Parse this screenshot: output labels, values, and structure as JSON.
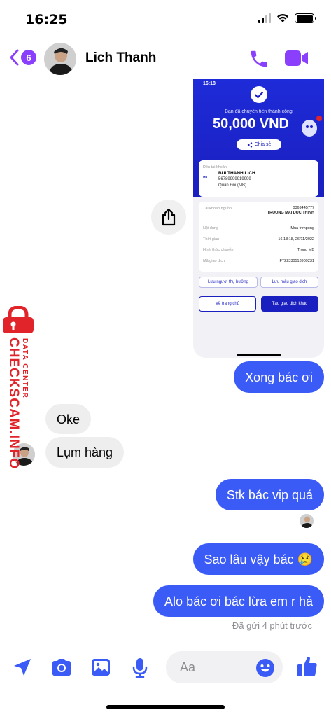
{
  "status_bar": {
    "time": "16:25"
  },
  "header": {
    "back_count": "6",
    "contact_name": "Lich Thanh"
  },
  "transfer_screenshot": {
    "time": "16:18",
    "message": "Bạn đã chuyển tiền thành công",
    "amount": "50,000 VND",
    "share_label": "Chia sẻ",
    "to_label": "Đến tài khoản",
    "recipient_name": "BUI THANH LICH",
    "recipient_account": "56789999919999",
    "recipient_bank": "Quân Đội (MB)",
    "bank_logo": "MB",
    "source_label": "Tài khoản nguồn",
    "source_account": "0369445777",
    "source_name": "TRUONG MAI DUC THINH",
    "content_label": "Nội dung",
    "content_value": "Mua frimpong",
    "time_label": "Thời gian",
    "time_value": "16:18:18, 26/11/2022",
    "method_label": "Hình thức chuyển",
    "method_value": "Trong MB",
    "txn_label": "Mã giao dịch",
    "txn_value": "FT22330513909231",
    "save_recipient": "Lưu người thụ hưởng",
    "save_template": "Lưu mẫu giao dịch",
    "home_button": "Về trang chủ",
    "new_txn_button": "Tạo giao dịch khác"
  },
  "messages": {
    "m1": "Xong bác ơi",
    "m2": "Oke",
    "m3": "Lụm hàng",
    "m4": "Stk bác vip quá",
    "m5": "Sao lâu vậy bác 😢",
    "m6": "Alo bác ơi bác lừa em r hả"
  },
  "sent_status": "Đã gửi 4 phút trước",
  "watermark": {
    "main": "CHECKSCAM.INFO",
    "sub": "DATA CENTER"
  },
  "composer": {
    "placeholder": "Aa"
  },
  "colors": {
    "accent": "#8a3ffc",
    "outgoing_bubble": "#3b5bf7",
    "incoming_bubble": "#eeeeef",
    "composer_icon": "#3b5bf7",
    "watermark": "#e0242a"
  },
  "icons": [
    "back-chevron-icon",
    "phone-icon",
    "video-camera-icon",
    "share-icon",
    "location-arrow-icon",
    "camera-icon",
    "image-icon",
    "microphone-icon",
    "emoji-icon",
    "thumbs-up-icon",
    "padlock-icon"
  ]
}
